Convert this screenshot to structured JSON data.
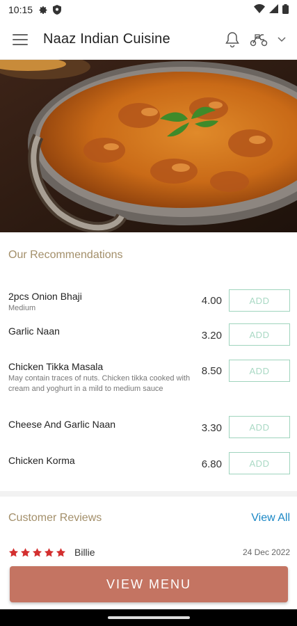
{
  "status_bar": {
    "time": "10:15"
  },
  "app_bar": {
    "title": "Naaz Indian Cuisine"
  },
  "recommendations": {
    "title": "Our Recommendations",
    "add_label": "ADD",
    "items": [
      {
        "name": "2pcs Onion Bhaji",
        "desc": "Medium",
        "price": "4.00"
      },
      {
        "name": "Garlic Naan",
        "desc": "",
        "price": "3.20"
      },
      {
        "name": "Chicken Tikka Masala",
        "desc": "May contain traces of nuts. Chicken tikka cooked with cream and yoghurt in a mild to medium sauce",
        "price": "8.50"
      },
      {
        "name": "Cheese And Garlic Naan",
        "desc": "",
        "price": "3.30"
      },
      {
        "name": "Chicken Korma",
        "desc": "",
        "price": "6.80"
      }
    ]
  },
  "reviews": {
    "title": "Customer Reviews",
    "view_all": "View All",
    "items": [
      {
        "rating": 5,
        "name": "Billie",
        "date": "24 Dec 2022"
      }
    ]
  },
  "cta": {
    "label": "VIEW MENU"
  },
  "colors": {
    "accent_gold": "#a38f6a",
    "add_green": "#9fd4bd",
    "link_blue": "#1a87c5",
    "cta": "#c47462",
    "star": "#d32f2f"
  }
}
